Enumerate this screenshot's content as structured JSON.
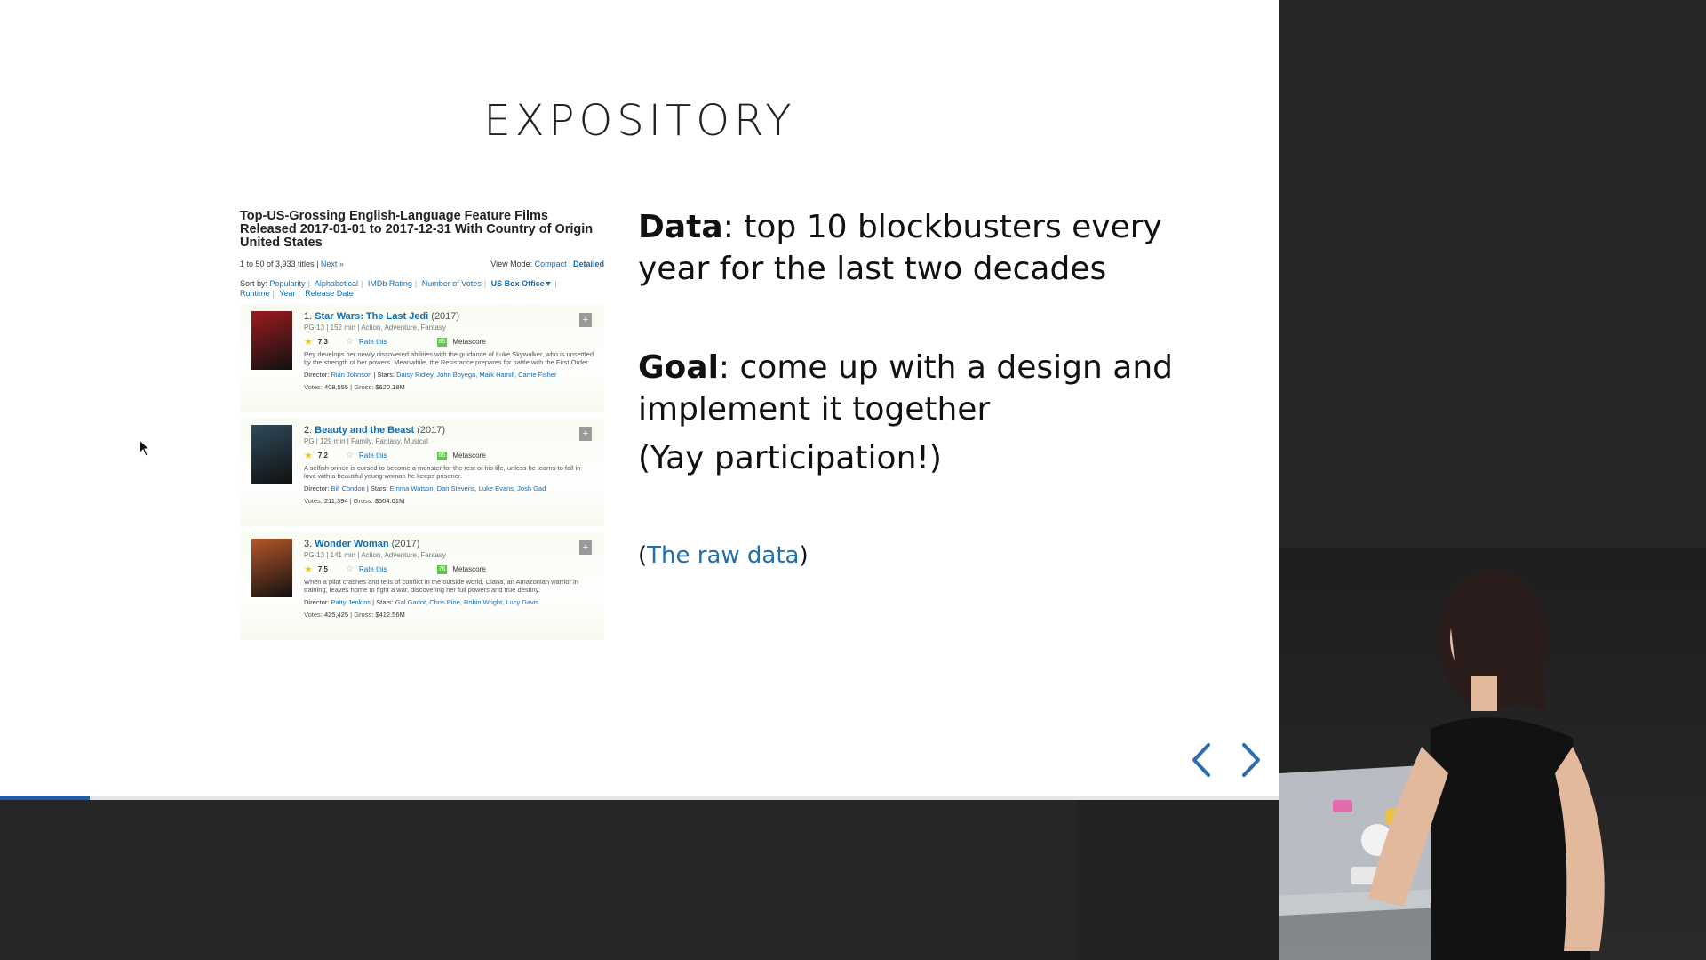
{
  "slide": {
    "title": "EXPOSITORY",
    "text": {
      "data_label": "Data",
      "data_text": ": top 10 blockbusters every year for the last two decades",
      "goal_label": "Goal",
      "goal_text": ": come up with a design and implement it together",
      "participation": "(Yay participation!)",
      "raw_open": "(",
      "raw_link": "The raw data",
      "raw_close": ")"
    },
    "progress": 0.07
  },
  "imdb": {
    "heading": "Top-US-Grossing English-Language Feature Films Released 2017-01-01 to 2017-12-31 With Country of Origin United States",
    "count": "1 to 50 of 3,933 titles",
    "next": "Next »",
    "view_mode_label": "View Mode:",
    "view_compact": "Compact",
    "view_detailed": "Detailed",
    "sort_label": "Sort by:",
    "sort_options": [
      "Popularity",
      "Alphabetical",
      "IMDb Rating",
      "Number of Votes",
      "US Box Office▼",
      "Runtime",
      "Year",
      "Release Date"
    ],
    "rate_this": "Rate this",
    "metascore_label": "Metascore",
    "director_label": "Director:",
    "stars_label": "Stars:",
    "votes_label": "Votes:",
    "gross_label": "Gross:",
    "movies": [
      {
        "rank": "1.",
        "title": "Star Wars: The Last Jedi",
        "year": "(2017)",
        "cert": "PG-13",
        "runtime": "152 min",
        "genre": "Action, Adventure, Fantasy",
        "rating": "7.3",
        "metascore": "85",
        "desc": "Rey develops her newly discovered abilities with the guidance of Luke Skywalker, who is unsettled by the strength of her powers. Meanwhile, the Resistance prepares for battle with the First Order.",
        "director": "Rian Johnson",
        "stars": "Daisy Ridley, John Boyega, Mark Hamill, Carrie Fisher",
        "votes": "408,555",
        "gross": "$620.18M",
        "poster_color": "#9b1b1f"
      },
      {
        "rank": "2.",
        "title": "Beauty and the Beast",
        "year": "(2017)",
        "cert": "PG",
        "runtime": "129 min",
        "genre": "Family, Fantasy, Musical",
        "rating": "7.2",
        "metascore": "65",
        "desc": "A selfish prince is cursed to become a monster for the rest of his life, unless he learns to fall in love with a beautiful young woman he keeps prisoner.",
        "director": "Bill Condon",
        "stars": "Emma Watson, Dan Stevens, Luke Evans, Josh Gad",
        "votes": "211,394",
        "gross": "$504.01M",
        "poster_color": "#2e4a5a"
      },
      {
        "rank": "3.",
        "title": "Wonder Woman",
        "year": "(2017)",
        "cert": "PG-13",
        "runtime": "141 min",
        "genre": "Action, Adventure, Fantasy",
        "rating": "7.5",
        "metascore": "76",
        "desc": "When a pilot crashes and tells of conflict in the outside world, Diana, an Amazonian warrior in training, leaves home to fight a war, discovering her full powers and true destiny.",
        "director": "Patty Jenkins",
        "stars": "Gal Gadot, Chris Pine, Robin Wright, Lucy Davis",
        "votes": "425,425",
        "gross": "$412.56M",
        "poster_color": "#b5562a"
      }
    ]
  },
  "nav": {
    "prev_icon": "chevron-left-icon",
    "next_icon": "chevron-right-icon",
    "arrow_color": "#2a6db0"
  }
}
